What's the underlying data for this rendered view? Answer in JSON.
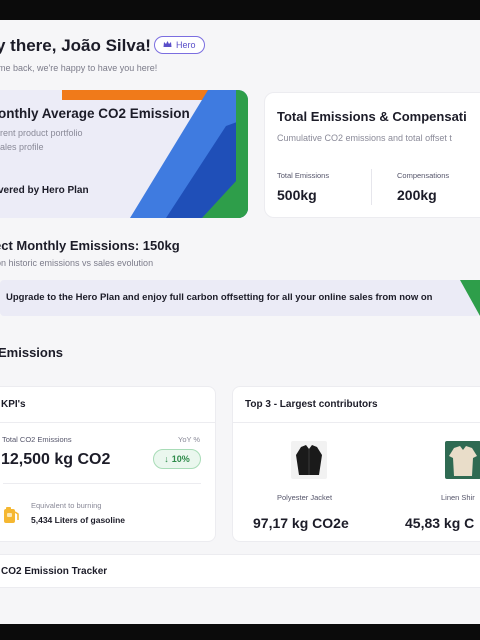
{
  "header": {
    "greeting": "y there, João Silva!",
    "badge": "Hero",
    "subtitle": "me back, we're happy to have you here!"
  },
  "avg_card": {
    "title": "onthly Average CO2 Emission",
    "line1": "rent product portfolio",
    "line2": "ales profile",
    "powered": "vered by Hero Plan",
    "colors": [
      "#f07a1a",
      "#3f7be0",
      "#1f4fb8",
      "#2e9e4a"
    ]
  },
  "totals_card": {
    "title": "Total Emissions & Compensati",
    "description": "Cumulative CO2 emissions and total offset t",
    "total_label": "Total Emissions",
    "total_value": "500kg",
    "comp_label": "Compensations",
    "comp_value": "200kg"
  },
  "expected": {
    "title": "ect Monthly Emissions: 150kg",
    "subtitle": "on historic emissions vs sales evolution"
  },
  "banner": {
    "text": "Upgrade to the Hero Plan and enjoy full carbon offsetting for all your online sales from now on"
  },
  "section_title": "Emissions",
  "kpis": {
    "title": "KPI's",
    "total_label": "Total CO2 Emissions",
    "yoy_label": "YoY %",
    "total_value": "12,500 kg CO2",
    "yoy_value": "10%",
    "equiv_label": "Equivalent to burning",
    "equiv_value": "5,434 Liters of gasoline"
  },
  "top3": {
    "title": "Top 3 - Largest contributors",
    "items": [
      {
        "name": "Polyester Jacket",
        "value": "97,17 kg CO2e"
      },
      {
        "name": "Linen Shir",
        "value": "45,83 kg C"
      }
    ]
  },
  "tracker": {
    "title": "CO2 Emission Tracker"
  }
}
